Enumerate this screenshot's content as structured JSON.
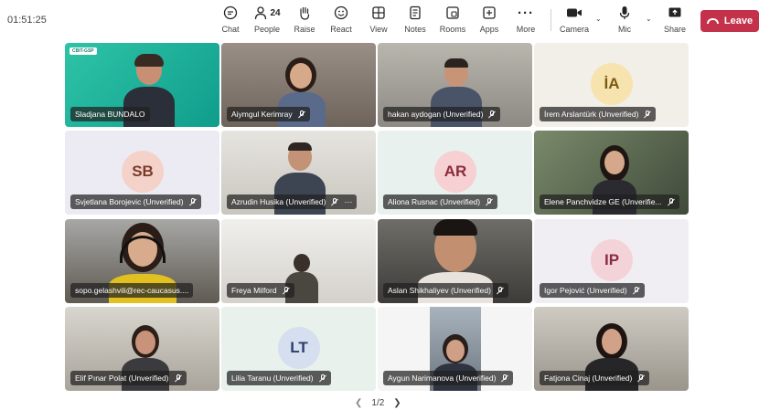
{
  "call": {
    "timer": "01:51:25"
  },
  "toolbar": {
    "chat": "Chat",
    "people_count": "24",
    "people": "People",
    "raise": "Raise",
    "react": "React",
    "view": "View",
    "notes": "Notes",
    "rooms": "Rooms",
    "apps": "Apps",
    "more": "More",
    "camera": "Camera",
    "mic": "Mic",
    "share": "Share",
    "leave": "Leave"
  },
  "logo": {
    "text": "CBIT-GSP"
  },
  "participants": [
    {
      "name": "Sladjana BUNDALO"
    },
    {
      "name": "Aiymgul Kerimray"
    },
    {
      "name": "hakan aydogan (Unverified)"
    },
    {
      "name": "İrem Arslantürk (Unverified)",
      "initials": "İA"
    },
    {
      "name": "Svjetlana Borojevic (Unverified)",
      "initials": "SB"
    },
    {
      "name": "Azrudin Husika (Unverified)"
    },
    {
      "name": "Aliona Rusnac (Unverified)",
      "initials": "AR"
    },
    {
      "name": "Elene Panchvidze GE (Unverifie..."
    },
    {
      "name": "sopo.gelashvili@rec-caucasus...."
    },
    {
      "name": "Freya Milford"
    },
    {
      "name": "Aslan Shikhaliyev (Unverified)"
    },
    {
      "name": "Igor Pejović (Unverified)",
      "initials": "IP"
    },
    {
      "name": "Elif Pınar Polat (Unverified)"
    },
    {
      "name": "Lilia Taranu (Unverified)",
      "initials": "LT"
    },
    {
      "name": "Aygun Narimanova (Unverified)"
    },
    {
      "name": "Fatjona Cinaj (Unverified)"
    }
  ],
  "pager": {
    "label": "1/2"
  },
  "colors": {
    "leave": "#c4314b",
    "accent": "#5b5fc7"
  }
}
